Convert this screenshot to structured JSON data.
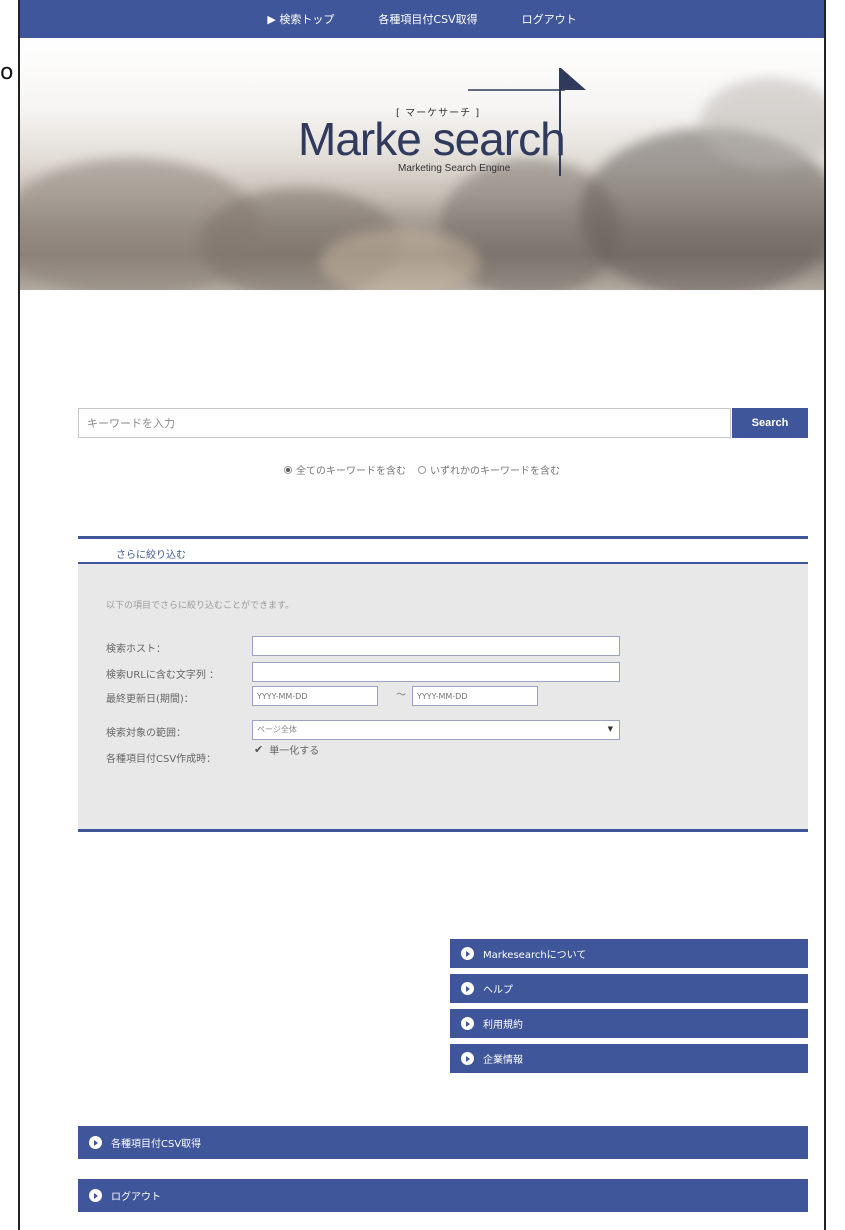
{
  "topnav": {
    "items": [
      "▶ 検索トップ",
      "各種項目付CSV取得",
      "ログアウト"
    ]
  },
  "logo": {
    "kana": "[ マーケサーチ ]",
    "title": "Marke search",
    "subtitle": "Marketing Search Engine"
  },
  "search": {
    "placeholder": "キーワードを入力",
    "button": "Search",
    "options": [
      "全てのキーワードを含む",
      "いずれかのキーワードを含む"
    ],
    "selected": "全てのキーワードを含む"
  },
  "filter": {
    "heading": "さらに絞り込む",
    "note": "以下の項目でさらに絞り込むことができます。",
    "host_label": "検索ホスト：",
    "url_label": "検索URLに含む文字列 ：",
    "date_label": "最終更新日(期間)：",
    "date_from_placeholder": "YYYY-MM-DD",
    "date_to_placeholder": "YYYY-MM-DD",
    "date_sep": "〜",
    "scope_label": "検索対象の範囲：",
    "scope_value": "ページ全体",
    "csv_label": "各種項目付CSV作成時：",
    "csv_option": "単一化する",
    "csv_checked": true
  },
  "side_links": [
    "Markesearchについて",
    "ヘルプ",
    "利用規約",
    "企業情報"
  ],
  "bottom_links": [
    "各種項目付CSV取得",
    "ログアウト"
  ],
  "stray_char": "o",
  "colors": {
    "primary": "#3f569a",
    "panel": "#e8e8e8"
  }
}
